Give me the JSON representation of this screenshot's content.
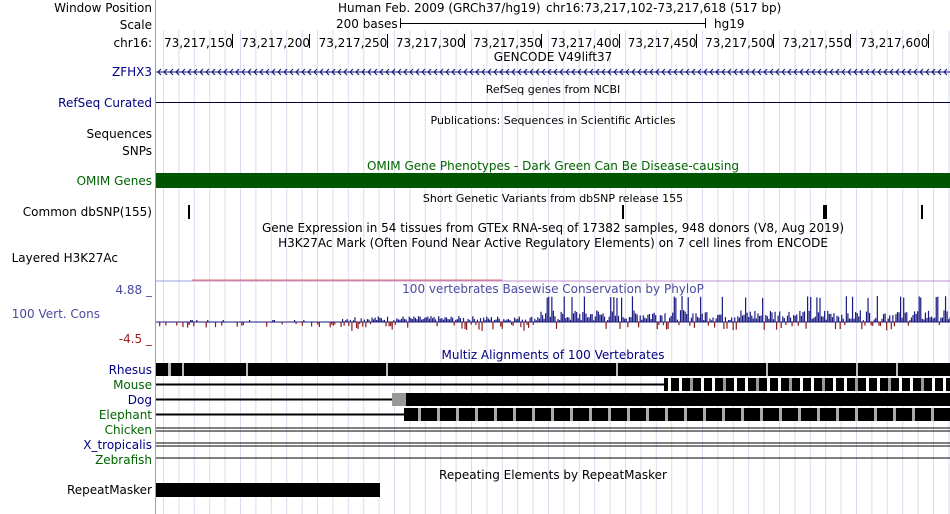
{
  "header": {
    "window_position_label": "Window Position",
    "scale_label": "Scale",
    "chrom_label": "chr16:",
    "assembly_text": "Human Feb. 2009 (GRCh37/hg19)",
    "position_text": "chr16:73,217,102-73,217,618 (517 bp)",
    "scale_text": "200 bases",
    "scale_db": "hg19",
    "ticks": [
      "73,217,150",
      "73,217,200",
      "73,217,250",
      "73,217,300",
      "73,217,350",
      "73,217,400",
      "73,217,450",
      "73,217,500",
      "73,217,550",
      "73,217,600"
    ]
  },
  "tracks": {
    "gencode": {
      "title": "GENCODE V49lift37",
      "label": "ZFHX3"
    },
    "refseq": {
      "title": "RefSeq genes from NCBI",
      "label": "RefSeq Curated"
    },
    "publications": {
      "title": "Publications: Sequences in Scientific Articles",
      "label": "Sequences"
    },
    "snps_pub": {
      "label": "SNPs"
    },
    "omim": {
      "title": "OMIM Gene Phenotypes - Dark Green Can Be Disease-causing",
      "label": "OMIM Genes",
      "color": "#005500"
    },
    "dbsnp": {
      "title": "Short Genetic Variants from dbSNP release 155",
      "label": "Common dbSNP(155)"
    },
    "gtex": {
      "title": "Gene Expression in 54 tissues from GTEx RNA-seq of 17382 samples, 948 donors (V8, Aug 2019)"
    },
    "h3k27ac": {
      "title": "H3K27Ac Mark (Often Found Near Active Regulatory Elements) on 7 cell lines from ENCODE",
      "label": "Layered H3K27Ac"
    },
    "phylop": {
      "title": "100 vertebrates Basewise Conservation by PhyloP",
      "label": "100 Vert. Cons",
      "max_label": "4.88 _",
      "min_label": "-4.5 _",
      "pos_color": "#1a1a80",
      "neg_color": "#8b1a1a"
    },
    "multiz": {
      "title": "Multiz Alignments of 100 Vertebrates",
      "species": [
        "Rhesus",
        "Mouse",
        "Dog",
        "Elephant",
        "Chicken",
        "X_tropicalis",
        "Zebrafish"
      ]
    },
    "repeatmasker": {
      "title": "Repeating Elements by RepeatMasker",
      "label": "RepeatMasker"
    }
  }
}
